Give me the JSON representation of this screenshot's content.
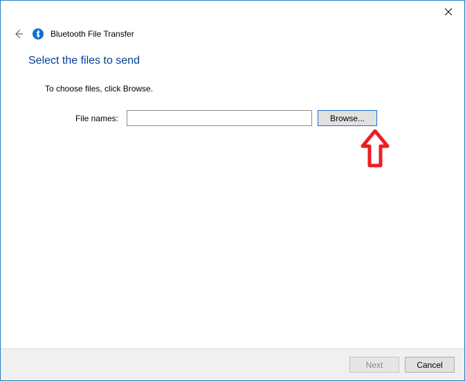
{
  "titlebar": {
    "close_label": "Close"
  },
  "header": {
    "window_title": "Bluetooth File Transfer"
  },
  "content": {
    "heading": "Select the files to send",
    "instruction": "To choose files, click Browse.",
    "field_label": "File names:",
    "file_value": "",
    "browse_label": "Browse..."
  },
  "footer": {
    "next_label": "Next",
    "cancel_label": "Cancel"
  }
}
